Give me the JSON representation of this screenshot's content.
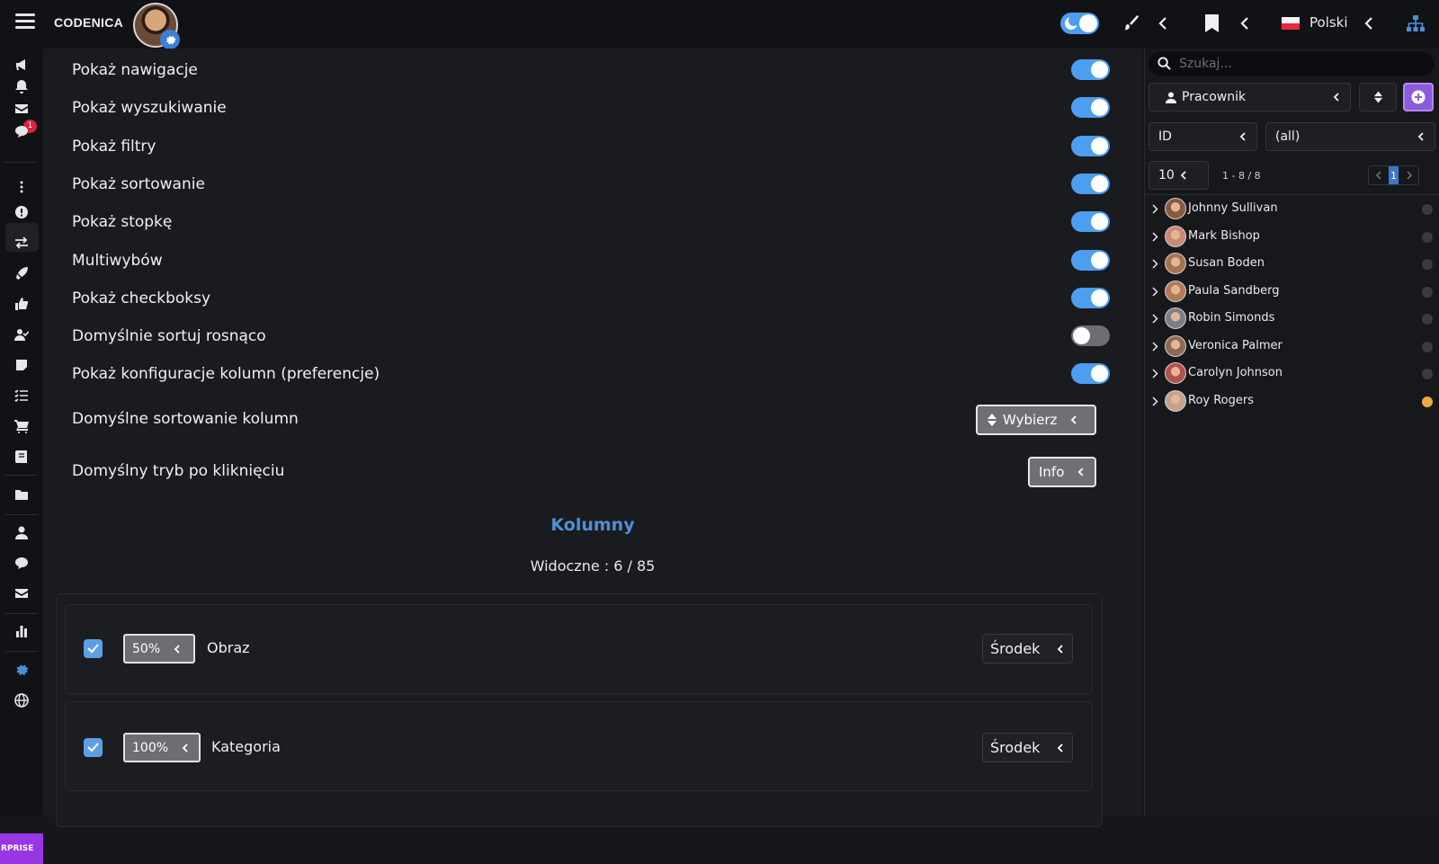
{
  "app": {
    "brand": "CODENICA",
    "language": "Polski",
    "badge_count": "1",
    "enterprise_label": "RPRISE"
  },
  "settings": [
    {
      "label": "Pokaż nawigacje",
      "on": true
    },
    {
      "label": "Pokaż wyszukiwanie",
      "on": true
    },
    {
      "label": "Pokaż filtry",
      "on": true
    },
    {
      "label": "Pokaż sortowanie",
      "on": true
    },
    {
      "label": "Pokaż stopkę",
      "on": true
    },
    {
      "label": "Multiwybów",
      "on": true
    },
    {
      "label": "Pokaż checkboksy",
      "on": true
    },
    {
      "label": "Domyślnie sortuj rosnąco",
      "on": false
    },
    {
      "label": "Pokaż konfiguracje kolumn (preferencje)",
      "on": true
    }
  ],
  "default_sort": {
    "label": "Domyślne sortowanie kolumn",
    "button": "Wybierz"
  },
  "click_mode": {
    "label": "Domyślny tryb po kliknięciu",
    "button": "Info"
  },
  "columns": {
    "title": "Kolumny",
    "visible": "Widoczne : 6 / 85",
    "items": [
      {
        "width": "50%",
        "name": "Obraz",
        "align": "Środek",
        "checked": true
      },
      {
        "width": "100%",
        "name": "Kategoria",
        "align": "Środek",
        "checked": true
      }
    ]
  },
  "right_panel": {
    "search_placeholder": "Szukaj...",
    "entity": "Pracownik",
    "filter_field": "ID",
    "filter_value": "(all)",
    "page_size": "10",
    "range": "1 - 8 / 8",
    "page": "1",
    "people": [
      {
        "name": "Johnny Sullivan",
        "status_color": "#3a3b40",
        "avatar_color": "#8a5a3c"
      },
      {
        "name": "Mark Bishop",
        "status_color": "#3a3b40",
        "avatar_color": "#c98a74"
      },
      {
        "name": "Susan Boden",
        "status_color": "#3a3b40",
        "avatar_color": "#a7734f"
      },
      {
        "name": "Paula Sandberg",
        "status_color": "#3a3b40",
        "avatar_color": "#b57a5b"
      },
      {
        "name": "Robin Simonds",
        "status_color": "#3a3b40",
        "avatar_color": "#7d7f85"
      },
      {
        "name": "Veronica Palmer",
        "status_color": "#3a3b40",
        "avatar_color": "#8c6a55"
      },
      {
        "name": "Carolyn Johnson",
        "status_color": "#3a3b40",
        "avatar_color": "#b4504c"
      },
      {
        "name": "Roy Rogers",
        "status_color": "#f2a93b",
        "avatar_color": "#c7a18b"
      }
    ]
  },
  "colors": {
    "accent": "#4c9ef0",
    "title_blue": "#4f8fd6",
    "purple": "#9a35e6",
    "badge_red": "#d6263a"
  }
}
